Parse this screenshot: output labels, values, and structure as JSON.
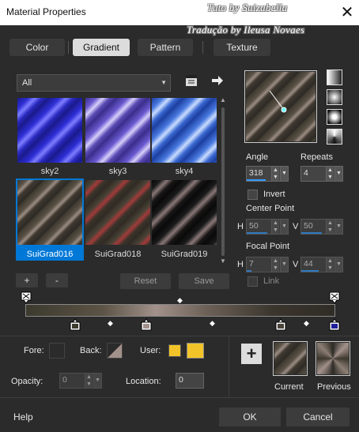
{
  "window": {
    "title": "Material Properties",
    "watermark_line1": "Tuto by Suizabella",
    "watermark_line2": "Tradução by Ileusa Novaes",
    "close_glyph": "✕"
  },
  "tabs": [
    {
      "label": "Color",
      "active": false
    },
    {
      "label": "Gradient",
      "active": true
    },
    {
      "label": "Pattern",
      "active": false
    },
    {
      "label": "Texture",
      "active": false
    }
  ],
  "filter": {
    "selected": "All"
  },
  "gradients": [
    {
      "name": "sky2",
      "selected": false
    },
    {
      "name": "sky3",
      "selected": false
    },
    {
      "name": "sky4",
      "selected": false
    },
    {
      "name": "SuiGrad016",
      "selected": true
    },
    {
      "name": "SuiGrad018",
      "selected": false
    },
    {
      "name": "SuiGrad019",
      "selected": false
    }
  ],
  "list_buttons": {
    "add": "+",
    "remove": "-",
    "reset": "Reset",
    "save": "Save"
  },
  "angle": {
    "label": "Angle",
    "value": "318"
  },
  "repeats": {
    "label": "Repeats",
    "value": "4"
  },
  "invert": {
    "label": "Invert",
    "checked": false
  },
  "center_point": {
    "label": "Center Point",
    "h_label": "H",
    "h_value": "50",
    "v_label": "V",
    "v_value": "50"
  },
  "focal_point": {
    "label": "Focal Point",
    "h_label": "H",
    "h_value": "7",
    "v_label": "V",
    "v_value": "44"
  },
  "link": {
    "label": "Link",
    "checked": false
  },
  "editor": {
    "fore_label": "Fore:",
    "back_label": "Back:",
    "user_label": "User:",
    "opacity_label": "Opacity:",
    "opacity_value": "0",
    "location_label": "Location:",
    "location_value": "0",
    "user_color": "#f2c429"
  },
  "preview": {
    "current_label": "Current",
    "previous_label": "Previous",
    "add_glyph": "+"
  },
  "footer": {
    "help": "Help",
    "ok": "OK",
    "cancel": "Cancel"
  },
  "colors": {
    "accent": "#3399ff",
    "selection": "#0078d7"
  }
}
